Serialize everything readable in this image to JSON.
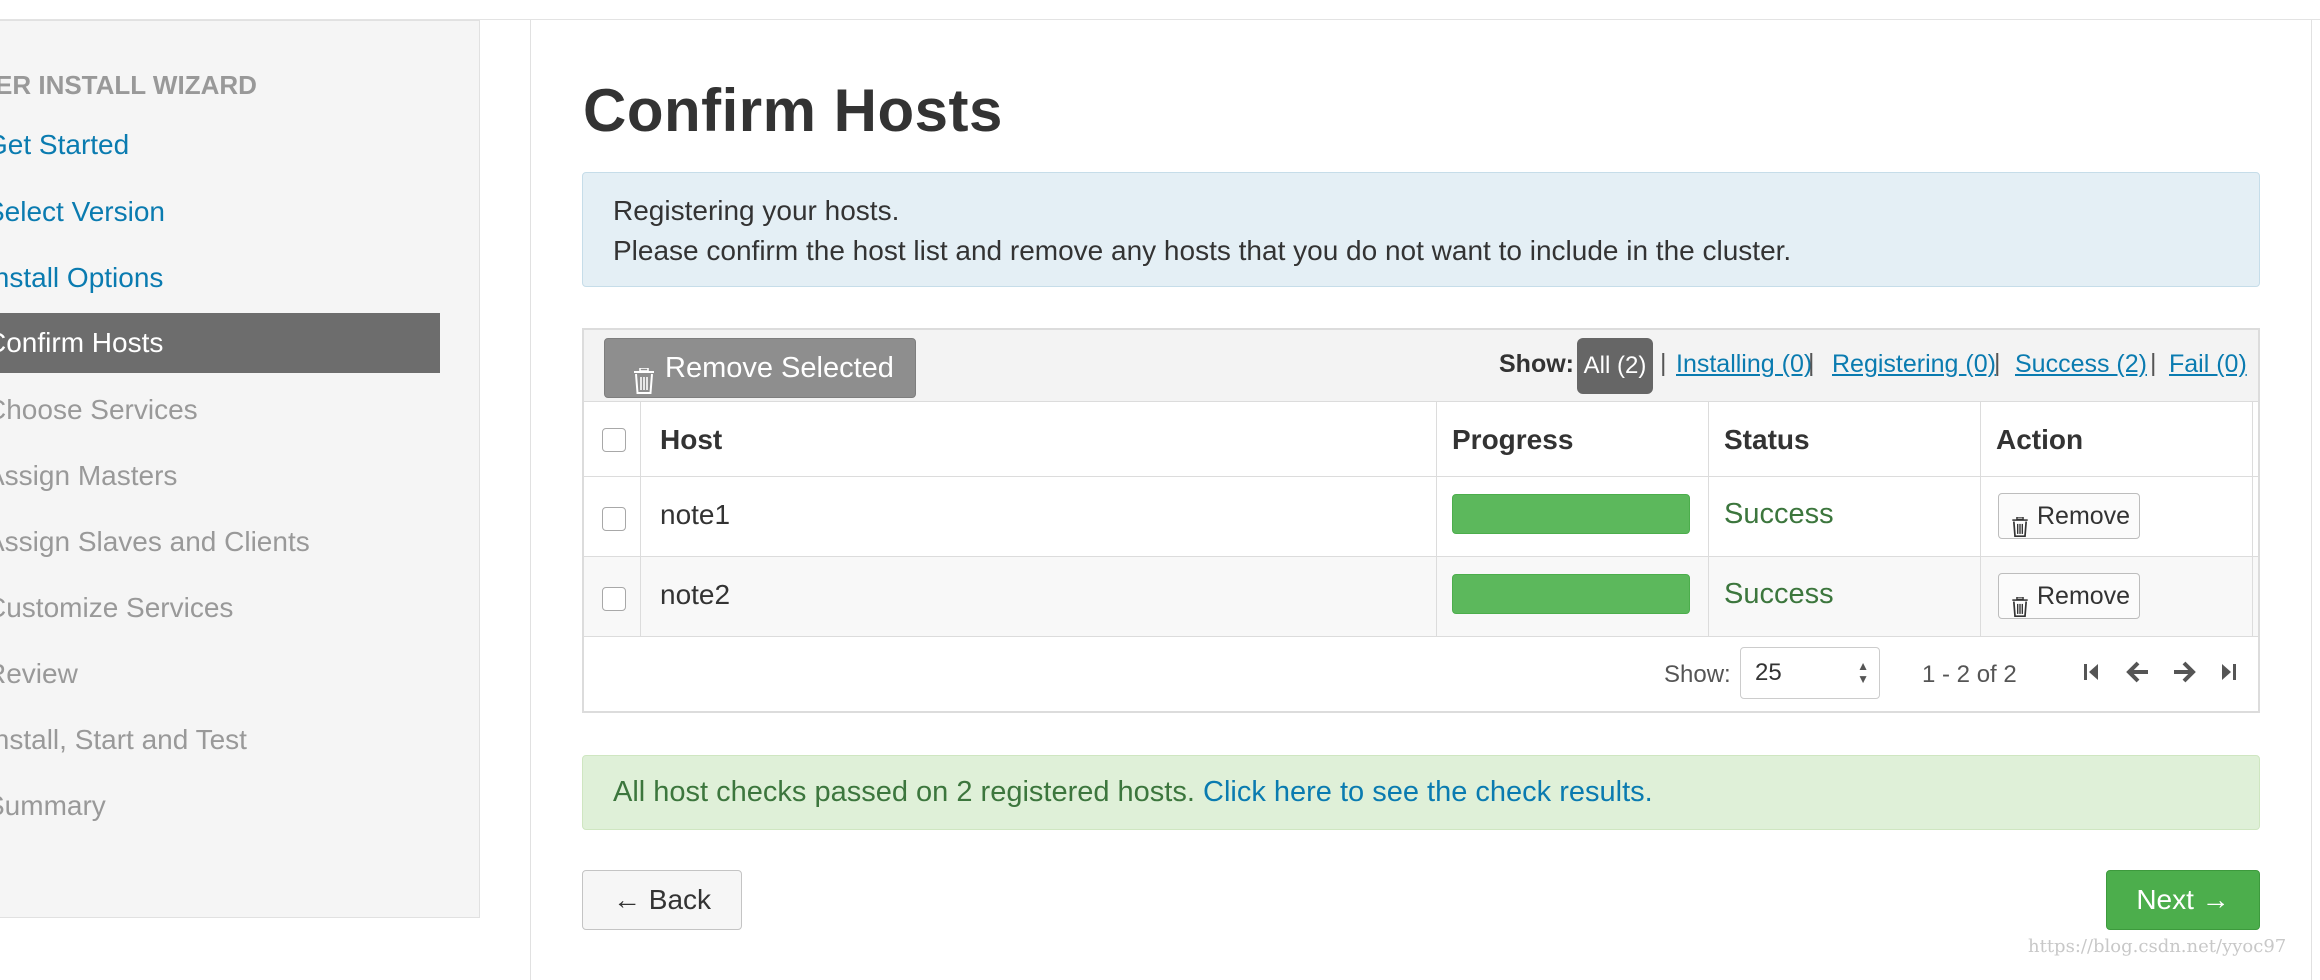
{
  "sidebar": {
    "title": "USTER INSTALL WIZARD",
    "items": [
      {
        "label": "Get Started",
        "state": "done"
      },
      {
        "label": "Select Version",
        "state": "done"
      },
      {
        "label": "Install Options",
        "state": "done"
      },
      {
        "label": "Confirm Hosts",
        "state": "active"
      },
      {
        "label": "Choose Services",
        "state": "todo"
      },
      {
        "label": "Assign Masters",
        "state": "todo"
      },
      {
        "label": "Assign Slaves and Clients",
        "state": "todo"
      },
      {
        "label": "Customize Services",
        "state": "todo"
      },
      {
        "label": "Review",
        "state": "todo"
      },
      {
        "label": "Install, Start and Test",
        "state": "todo"
      },
      {
        "label": "Summary",
        "state": "todo"
      }
    ]
  },
  "main": {
    "title": "Confirm Hosts",
    "info_line1": "Registering your hosts.",
    "info_line2": "Please confirm the host list and remove any hosts that you do not want to include in the cluster.",
    "toolbar": {
      "remove_selected_label": "Remove Selected",
      "show_label": "Show:",
      "filters": {
        "all": "All (2)",
        "installing": "Installing (0)",
        "registering": "Registering (0)",
        "success": "Success (2)",
        "fail": "Fail (0)"
      },
      "separator": "|"
    },
    "table": {
      "columns": [
        "Host",
        "Progress",
        "Status",
        "Action"
      ],
      "rows": [
        {
          "host": "note1",
          "progress": 1.0,
          "status": "Success",
          "action": "Remove"
        },
        {
          "host": "note2",
          "progress": 1.0,
          "status": "Success",
          "action": "Remove"
        }
      ]
    },
    "pager": {
      "show_label": "Show:",
      "page_size": "25",
      "range": "1 - 2 of 2"
    },
    "checks": {
      "text": "All host checks passed on 2 registered hosts.",
      "link": "Click here to see the check results."
    },
    "back_label": "← Back",
    "next_label": "Next →"
  },
  "watermark": "https://blog.csdn.net/yyoc97",
  "colors": {
    "link": "#0a7bb0",
    "active_nav": "#6d6d6d",
    "success": "#3c763d",
    "progress": "#5cb85c",
    "next_button": "#4cae4c"
  },
  "icons": [
    "trash-icon",
    "first-page-icon",
    "prev-page-icon",
    "next-page-icon",
    "last-page-icon",
    "select-arrows-icon"
  ]
}
